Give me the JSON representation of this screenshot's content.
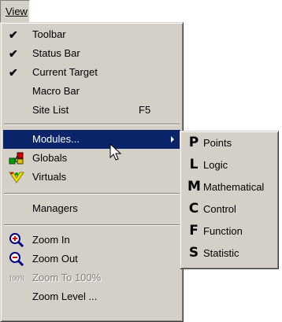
{
  "menubar": {
    "view_label": "View"
  },
  "menu": {
    "toolbar": "Toolbar",
    "status_bar": "Status Bar",
    "current_target": "Current Target",
    "macro_bar": "Macro Bar",
    "site_list": "Site List",
    "site_list_shortcut": "F5",
    "modules": "Modules...",
    "globals": "Globals",
    "virtuals": "Virtuals",
    "managers": "Managers",
    "zoom_in": "Zoom In",
    "zoom_out": "Zoom Out",
    "zoom_100": "Zoom To 100%",
    "zoom_100_icon_text": "100%",
    "zoom_level": "Zoom Level ..."
  },
  "submenu": {
    "items": [
      {
        "letter": "P",
        "label": "Points"
      },
      {
        "letter": "L",
        "label": "Logic"
      },
      {
        "letter": "M",
        "label": "Mathematical"
      },
      {
        "letter": "C",
        "label": "Control"
      },
      {
        "letter": "F",
        "label": "Function"
      },
      {
        "letter": "S",
        "label": "Statistic"
      }
    ]
  },
  "checked": {
    "toolbar": true,
    "status_bar": true,
    "current_target": true
  },
  "colors": {
    "menu_bg": "#d4d0c8",
    "highlight": "#0a246a"
  },
  "icons": {
    "modules_arrow": "submenu-arrow-icon",
    "globals": "globals-icon",
    "virtuals": "virtuals-icon",
    "zoom_in": "zoom-in-icon",
    "zoom_out": "zoom-out-icon",
    "zoom_100": "zoom-100-icon"
  }
}
